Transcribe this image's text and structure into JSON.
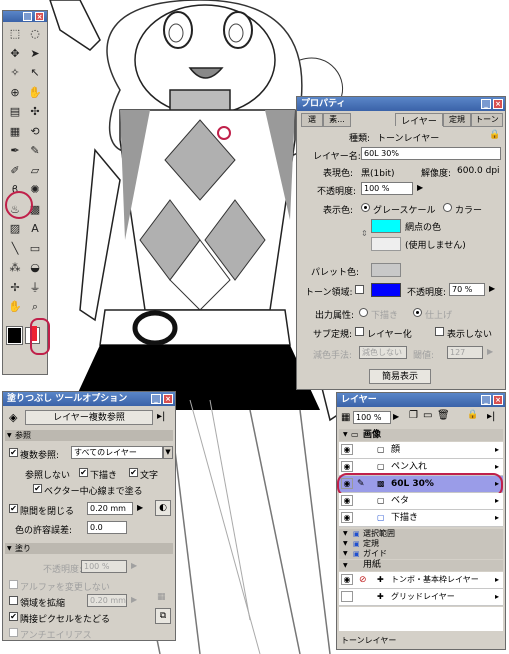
{
  "properties": {
    "title": "プロパティ",
    "tabs": [
      "選",
      "素...",
      "レイヤー",
      "定規",
      "トーン"
    ],
    "type_label": "種類:",
    "type_value": "トーンレイヤー",
    "name_label": "レイヤー名:",
    "name_value": "60L 30%",
    "expression_label": "表現色:",
    "expression_value": "黒(1bit)",
    "resolution_label": "解像度:",
    "resolution_value": "600.0 dpi",
    "opacity_label": "不透明度:",
    "opacity_value": "100 %",
    "display_color_label": "表示色:",
    "grayscale_label": "グレースケール",
    "color_label": "カラー",
    "dot_color_label": "網点の色",
    "unused_label": "(使用しません)",
    "palette_color_label": "パレット色:",
    "tone_area_label": "トーン領域:",
    "tone_opacity_label": "不透明度:",
    "tone_opacity_value": "70 %",
    "output_label": "出力属性:",
    "draft_label": "下描き",
    "finish_label": "仕上げ",
    "sub_ruler_label": "サブ定規:",
    "layerize_label": "レイヤー化",
    "hide_label": "表示しない",
    "subtract_label": "減色手法:",
    "subtract_value": "減色しない",
    "threshold_label": "閾値:",
    "threshold_value": "127",
    "simple_button": "簡易表示",
    "colors": {
      "dot": "#00ffff",
      "tone_area": "#0000ff",
      "palette": "#c8c8c8"
    }
  },
  "fill_options": {
    "title": "塗りつぶし ツールオプション",
    "multi_ref_button": "レイヤー複数参照",
    "section_ref": "参照",
    "multi_ref_label": "複数参照:",
    "multi_ref_value": "すべてのレイヤー",
    "no_ref_label": "参照しない",
    "draft_label": "下描き",
    "text_label": "文字",
    "vector_label": "ベクター中心線まで塗る",
    "gap_label": "隙間を閉じる",
    "gap_value": "0.20 mm",
    "tolerance_label": "色の許容誤差:",
    "tolerance_value": "0.0",
    "section_fill": "塗り",
    "opacity_label": "不透明度:",
    "opacity_value": "100 %",
    "alpha_label": "アルファを変更しない",
    "expand_label": "領域を拡縮",
    "expand_value": "0.20 mm",
    "adjacent_label": "隣接ピクセルをたどる",
    "antialias_label": "アンチエイリアス"
  },
  "layers": {
    "title": "レイヤー",
    "opacity_value": "100 %",
    "folder_label": "画像",
    "items": [
      "顔",
      "ペン入れ",
      "60L 30%",
      "ベタ",
      "下描き"
    ],
    "select_label": "選択範囲",
    "ruler_label": "定規",
    "guide_label": "ガイド",
    "paper_label": "用紙",
    "tombo_label": "トンボ・基本枠レイヤー",
    "grid_label": "グリッドレイヤー",
    "status": "トーンレイヤー",
    "colors": {
      "selected": "#9a9ce8",
      "highlight_ring": "#c0204a"
    }
  },
  "toolbox": {
    "tools": [
      "marquee-icon",
      "lasso-icon",
      "move-icon",
      "select-icon",
      "magic-wand-icon",
      "pointer-icon",
      "zoom-layer-icon",
      "grab-icon",
      "ruler-icon",
      "hand-move-icon",
      "grid-icon",
      "rotate-icon",
      "pen-icon",
      "pencil-icon",
      "marker-icon",
      "eraser-icon",
      "brush-icon",
      "airbrush-icon",
      "fill-icon",
      "pattern-icon",
      "gradation-icon",
      "text-icon",
      "line-icon",
      "rect-icon",
      "tone-icon",
      "color-fill-icon",
      "stamp-icon",
      "dropper-icon",
      "hand-icon",
      "magnifier-icon"
    ]
  }
}
